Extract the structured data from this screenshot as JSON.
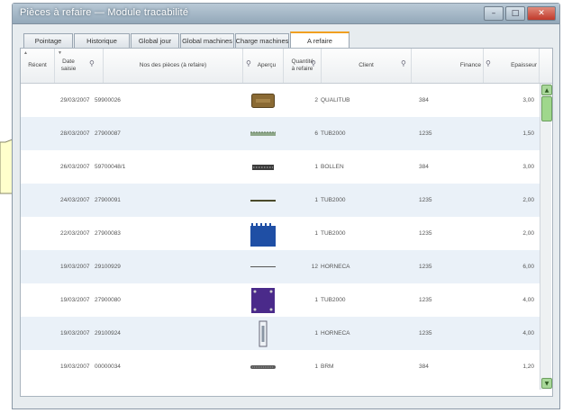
{
  "window": {
    "title": "Pièces à refaire — Module tracabilité",
    "min_label": "–",
    "max_label": "□",
    "close_label": "✕"
  },
  "tabs": [
    "Pointage",
    "Historique",
    "Global jour",
    "Global machines",
    "Charge machines",
    "A refaire"
  ],
  "active_tab": 5,
  "columns": {
    "recent": "Récent",
    "date": "Date saisie",
    "nums": "Nos des pièces (à refaire)",
    "apercu": "Aperçu",
    "quantite": "Quantité à refaire",
    "client": "Client",
    "finance": "Finance",
    "epaisseur": "Epaisseur"
  },
  "rows": [
    {
      "date": "29/03/2007",
      "piece": "59900026",
      "qty": "2",
      "client": "QUALITUB",
      "finance": "384",
      "ep": "3,00"
    },
    {
      "date": "28/03/2007",
      "piece": "27900087",
      "qty": "6",
      "client": "TUB2000",
      "finance": "1235",
      "ep": "1,50"
    },
    {
      "date": "26/03/2007",
      "piece": "59700048/1",
      "qty": "1",
      "client": "BOLLEN",
      "finance": "384",
      "ep": "3,00"
    },
    {
      "date": "24/03/2007",
      "piece": "27900091",
      "qty": "1",
      "client": "TUB2000",
      "finance": "1235",
      "ep": "2,00"
    },
    {
      "date": "22/03/2007",
      "piece": "27900083",
      "qty": "1",
      "client": "TUB2000",
      "finance": "1235",
      "ep": "2,00"
    },
    {
      "date": "19/03/2007",
      "piece": "29100929",
      "qty": "12",
      "client": "HORNECA",
      "finance": "1235",
      "ep": "6,00"
    },
    {
      "date": "19/03/2007",
      "piece": "27900080",
      "qty": "1",
      "client": "TUB2000",
      "finance": "1235",
      "ep": "4,00"
    },
    {
      "date": "19/03/2007",
      "piece": "29100924",
      "qty": "1",
      "client": "HORNECA",
      "finance": "1235",
      "ep": "4,00"
    },
    {
      "date": "19/03/2007",
      "piece": "00000034",
      "qty": "1",
      "client": "BRM",
      "finance": "384",
      "ep": "1,20"
    }
  ],
  "colors": {
    "row_alt": "#eaf1f8",
    "active_tab_accent": "#f0a020",
    "scroll_accent": "#9fd78c",
    "callout_fill": "#ffffcc"
  }
}
